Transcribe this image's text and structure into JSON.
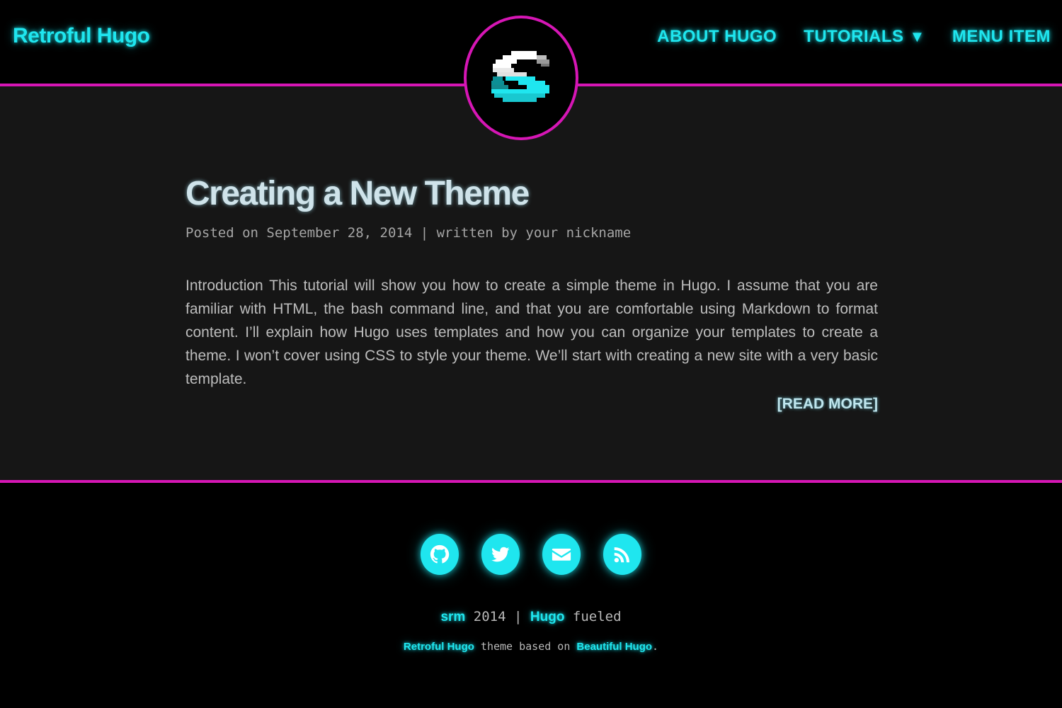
{
  "brand": {
    "title": "Retroful Hugo"
  },
  "nav": {
    "items": [
      {
        "label": "ABOUT HUGO"
      },
      {
        "label": "TUTORIALS",
        "caret": "▼"
      },
      {
        "label": "MENU ITEM"
      }
    ]
  },
  "avatar": {
    "icon": "pixel-s-logo-icon"
  },
  "post": {
    "title": "Creating a New Theme",
    "meta": "Posted on September 28, 2014 | written by your nickname",
    "excerpt": "Introduction This tutorial will show you how to create a simple theme in Hugo. I assume that you are familiar with HTML, the bash command line, and that you are comfortable using Markdown to format content. I’ll explain how Hugo uses templates and how you can organize your templates to create a theme. I won’t cover using CSS to style your theme. We’ll start with creating a new site with a very basic template.",
    "read_more": "[READ MORE]"
  },
  "footer": {
    "socials": [
      {
        "icon": "github-icon"
      },
      {
        "icon": "twitter-icon"
      },
      {
        "icon": "email-icon"
      },
      {
        "icon": "rss-icon"
      }
    ],
    "author": "srm",
    "year": "2014",
    "separator": "|",
    "hugo_link": "Hugo",
    "fueled": "fueled",
    "theme_link": "Retroful Hugo",
    "theme_text": "theme based on",
    "base_link": "Beautiful Hugo",
    "period": "."
  },
  "colors": {
    "accent": "#1fe6ef",
    "border": "#d616b5",
    "background": "#000000",
    "content_bg": "#161616"
  }
}
